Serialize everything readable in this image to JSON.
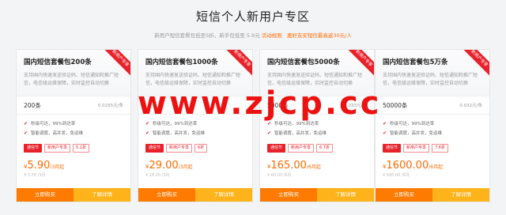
{
  "header": {
    "title": "短信个人新用户专区",
    "subtitle_text": "新用户短信套餐包低至5折，新手包低至 5.9元",
    "subtitle_link": "活动规则",
    "subtitle_highlight": "邀好友买短信最高返30元/人"
  },
  "plans": [
    {
      "name": "国内短信套餐包200条",
      "desc": "支持国内快速发送验证码、短信通知和推广短信，电信级运维保障，实时监控自动切换",
      "ribbon": "新用户专享",
      "quota": "200条",
      "unit_price": "0.0295元/条",
      "features": [
        "秒级可达，99%到达率",
        "智能调度，高并发，免运维"
      ],
      "tags": [
        "通信节",
        "新用户专享",
        "5.1折"
      ],
      "currency": "¥",
      "price": "5.90",
      "period": "/3月起",
      "original": "¥ 3.78 /3月",
      "buy_label": "立即购买",
      "more_label": "了解详情"
    },
    {
      "name": "国内短信套餐包1000条",
      "desc": "支持国内快速发送验证码、短信通知和推广短信，电信级运维保障，实时监控自动切换",
      "ribbon": "新用户专享",
      "quota": "",
      "unit_price": "",
      "features": [
        "秒级可达，99%到达率",
        "智能调度，高并发，免运维"
      ],
      "tags": [
        "通信节",
        "新用户专享",
        "6折"
      ],
      "currency": "¥",
      "price": "29.00",
      "period": "/3月起",
      "original": "¥ 18.00 /3月",
      "buy_label": "立即购买",
      "more_label": "了解详情"
    },
    {
      "name": "国内短信套餐包5000条",
      "desc": "支持国内快速发送验证码、短信通知和推广短信，电信级运维保障，实时监控自动切换",
      "ribbon": "新用户专享",
      "quota": "5000条",
      "unit_price": "0.033元/条",
      "features": [
        "秒级可达，99%到达率",
        "智能调度，高并发，免运维"
      ],
      "tags": [
        "通信节",
        "新用户专享",
        "6.7折"
      ],
      "currency": "¥",
      "price": "165.00",
      "period": "/6月起",
      "original": "¥ 60.00 /6月",
      "buy_label": "立即购买",
      "more_label": "了解详情"
    },
    {
      "name": "国内短信套餐包5万条",
      "desc": "支持国内快速发送验证码、短信通知和推广短信，电信级运维保障，实时监控自动切换",
      "ribbon": "新用户专享",
      "quota": "50000条",
      "unit_price": "0.032元/条",
      "features": [
        "秒级可达，99%到达率",
        "智能调度，高并发，免运维"
      ],
      "tags": [
        "通信节",
        "新用户专享",
        "7.6折"
      ],
      "currency": "¥",
      "price": "1600.00",
      "period": "/6月起",
      "original": "¥ 500.00 /6月",
      "buy_label": "立即购买",
      "more_label": "了解详情"
    }
  ],
  "watermark": "www.zjcp.cc",
  "colors": {
    "accent_orange": "#ff7a00",
    "accent_yellow": "#ffb31a",
    "brand_red": "#e8222b"
  }
}
